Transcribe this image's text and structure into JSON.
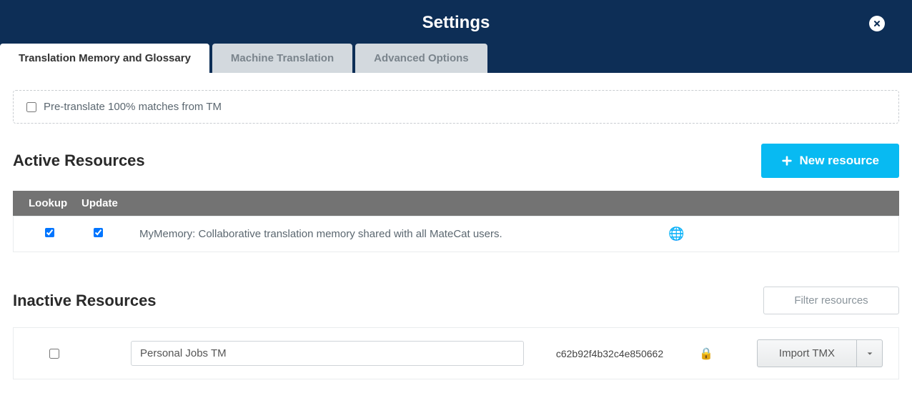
{
  "header": {
    "title": "Settings"
  },
  "tabs": [
    {
      "label": "Translation Memory and Glossary",
      "active": true
    },
    {
      "label": "Machine Translation",
      "active": false
    },
    {
      "label": "Advanced Options",
      "active": false
    }
  ],
  "pretranslate": {
    "label": "Pre-translate 100% matches from TM",
    "checked": false
  },
  "active_section": {
    "title": "Active Resources",
    "new_button_label": "New resource",
    "columns": {
      "lookup": "Lookup",
      "update": "Update"
    },
    "rows": [
      {
        "lookup": true,
        "update": true,
        "description": "MyMemory: Collaborative translation memory shared with all MateCat users.",
        "icon": "globe-icon"
      }
    ]
  },
  "inactive_section": {
    "title": "Inactive Resources",
    "filter_placeholder": "Filter resources",
    "rows": [
      {
        "checked": false,
        "name": "Personal Jobs TM",
        "key": "c62b92f4b32c4e850662",
        "locked": true,
        "action_label": "Import TMX"
      }
    ]
  }
}
